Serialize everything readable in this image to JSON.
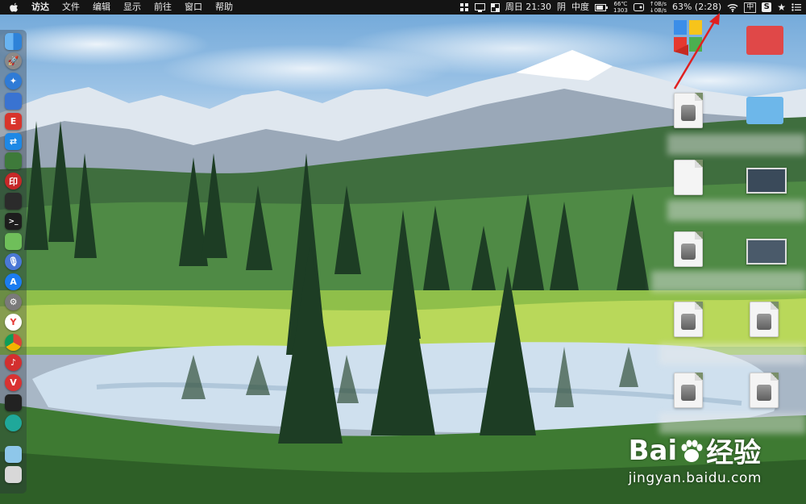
{
  "menubar": {
    "app_name": "访达",
    "menus": [
      "文件",
      "编辑",
      "显示",
      "前往",
      "窗口",
      "帮助"
    ],
    "status": {
      "temp_top": "66℃",
      "temp_bottom": "1303",
      "net_up": "0B/s",
      "net_down": "0B/s",
      "battery": "63% (2:28)",
      "clock": "周日 21:30",
      "weather": "阴",
      "weather_level": "中度",
      "ime": "中",
      "s_icon": "S"
    }
  },
  "dock": {
    "items": [
      {
        "icon": "finder-icon",
        "color": "#3a8ee6",
        "glyph": ""
      },
      {
        "icon": "launchpad-icon",
        "color": "#8a8a8a",
        "glyph": ""
      },
      {
        "icon": "safari-icon",
        "color": "#2f7bd6",
        "glyph": ""
      },
      {
        "icon": "preview-icon",
        "color": "#3973d1",
        "glyph": ""
      },
      {
        "icon": "app-red-icon",
        "color": "#d8342b",
        "glyph": ""
      },
      {
        "icon": "teamviewer-icon",
        "color": "#1e88e5",
        "glyph": ""
      },
      {
        "icon": "app-green-icon",
        "color": "#3e7a3a",
        "glyph": ""
      },
      {
        "icon": "app-red2-icon",
        "color": "#c62828",
        "glyph": ""
      },
      {
        "icon": "activity-icon",
        "color": "#2b2b2b",
        "glyph": ""
      },
      {
        "icon": "terminal-icon",
        "color": "#1d1d1d",
        "glyph": ""
      },
      {
        "icon": "maps-icon",
        "color": "#6fbf5a",
        "glyph": ""
      },
      {
        "icon": "siri-icon",
        "color": "#4a78d6",
        "glyph": ""
      },
      {
        "icon": "appstore-icon",
        "color": "#1c7cf0",
        "glyph": ""
      },
      {
        "icon": "system-preferences-icon",
        "color": "#7a7a7a",
        "glyph": ""
      },
      {
        "icon": "yandex-icon",
        "color": "#e53935",
        "glyph": ""
      },
      {
        "icon": "chrome-icon",
        "color": "#f2b705",
        "glyph": ""
      },
      {
        "icon": "netease-music-icon",
        "color": "#d32f2f",
        "glyph": ""
      },
      {
        "icon": "vivaldi-icon",
        "color": "#d93232",
        "glyph": ""
      },
      {
        "icon": "terminal2-icon",
        "color": "#222",
        "glyph": ""
      },
      {
        "icon": "app-teal-icon",
        "color": "#1fa89a",
        "glyph": ""
      },
      {
        "icon": "downloads-folder-icon",
        "color": "#8ec7ea",
        "glyph": ""
      },
      {
        "icon": "trash-icon",
        "color": "#cfcfcf",
        "glyph": ""
      }
    ]
  },
  "watermark": {
    "brand_left": "Bai",
    "brand_right": "经验",
    "url": "jingyan.baidu.com"
  }
}
